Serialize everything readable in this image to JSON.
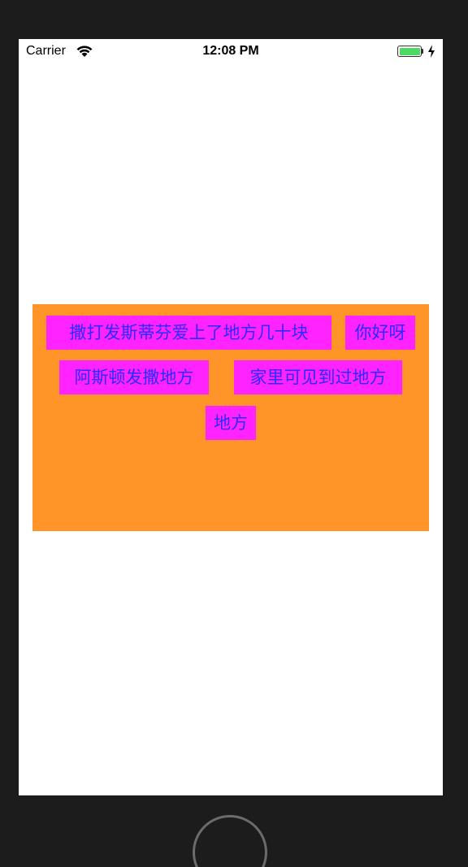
{
  "status_bar": {
    "carrier": "Carrier",
    "time": "12:08 PM",
    "icons": [
      "wifi-icon",
      "battery-icon",
      "charging-bolt-icon"
    ],
    "battery_color": "#4cd964"
  },
  "tag_view": {
    "background_color": "#ff9428",
    "tag_background_color": "#ff24ff",
    "tag_text_color": "#2b2bff",
    "tags": [
      "撒打发斯蒂芬爱上了地方几十块",
      "你好呀",
      "阿斯顿发撒地方",
      "家里可见到过地方",
      "地方"
    ]
  }
}
